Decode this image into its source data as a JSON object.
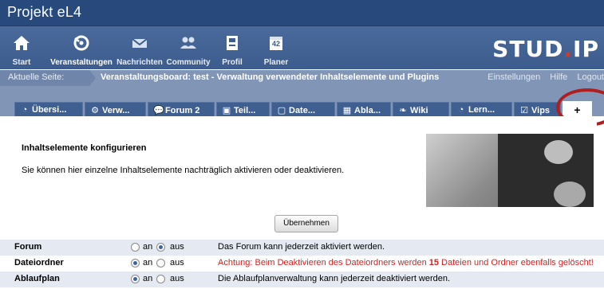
{
  "app": {
    "title": "Projekt eL4"
  },
  "nav": {
    "items": [
      {
        "label": "Start",
        "icon": "home-icon"
      },
      {
        "label": "Veranstaltungen",
        "icon": "courses-icon"
      },
      {
        "label": "Nachrichten",
        "icon": "mail-icon"
      },
      {
        "label": "Community",
        "icon": "community-icon"
      },
      {
        "label": "Profil",
        "icon": "profile-icon"
      },
      {
        "label": "Planer",
        "icon": "calendar-icon"
      }
    ],
    "planer_badge": "42",
    "logo_main": "STUD",
    "logo_dot": ".",
    "logo_end": "IP"
  },
  "crumb": {
    "label": "Aktuelle Seite:",
    "text": "Veranstaltungsboard: test - Verwaltung verwendeter Inhaltselemente und Plugins",
    "links": [
      "Einstellungen",
      "Hilfe",
      "Logout"
    ]
  },
  "tabs": [
    {
      "label": "Übersi...",
      "icon": "overview-icon",
      "glyph": "◔"
    },
    {
      "label": "Verw...",
      "icon": "admin-icon",
      "glyph": "⚙"
    },
    {
      "label": "Forum 2",
      "icon": "forum-icon",
      "glyph": "💬"
    },
    {
      "label": "Teil...",
      "icon": "participants-icon",
      "glyph": "▣"
    },
    {
      "label": "Date...",
      "icon": "files-icon",
      "glyph": "▢"
    },
    {
      "label": "Abla...",
      "icon": "schedule-icon",
      "glyph": "▦"
    },
    {
      "label": "Wiki",
      "icon": "wiki-icon",
      "glyph": "❧"
    },
    {
      "label": "Lern...",
      "icon": "learning-icon",
      "glyph": "◔"
    },
    {
      "label": "Vips",
      "icon": "vips-icon",
      "glyph": "☑"
    },
    {
      "label": "+",
      "icon": "add-icon",
      "glyph": ""
    }
  ],
  "content": {
    "heading": "Inhaltselemente konfigurieren",
    "description": "Sie können hier einzelne Inhaltselemente nachträglich aktivieren oder deaktivieren.",
    "apply_label": "Übernehmen"
  },
  "options": {
    "on_label": "an",
    "off_label": "aus",
    "rows": [
      {
        "name": "Forum",
        "state": "aus",
        "info": "Das Forum kann jederzeit aktiviert werden.",
        "warn": false
      },
      {
        "name": "Dateiordner",
        "state": "an",
        "info_pre": "Achtung: Beim Deaktivieren des Dateiordners werden ",
        "info_count": "15",
        "info_post": " Dateien und Ordner ebenfalls gelöscht!",
        "warn": true
      },
      {
        "name": "Ablaufplan",
        "state": "an",
        "info": "Die Ablaufplanverwaltung kann jederzeit deaktiviert werden.",
        "warn": false
      }
    ]
  },
  "colors": {
    "header": "#28497c",
    "nav": "#3d5c8e",
    "crumb": "#8196b7",
    "tab": "#3f5f91",
    "warning": "#d81f1f",
    "highlight_circle": "#b01f1f"
  }
}
